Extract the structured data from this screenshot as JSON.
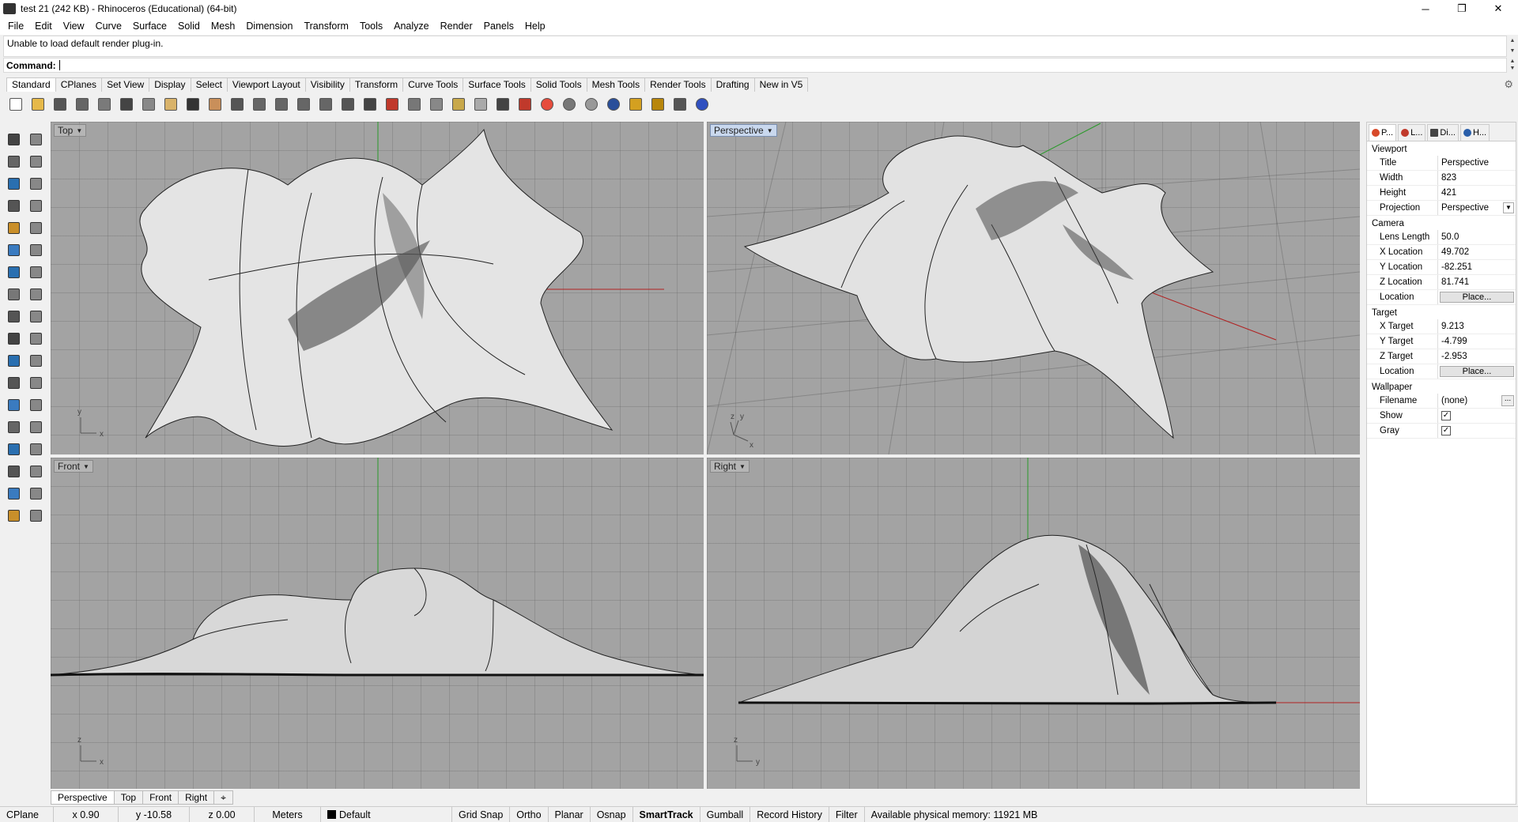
{
  "window": {
    "title": "test 21 (242 KB) - Rhinoceros (Educational) (64-bit)",
    "minimize": "─",
    "maximize": "❐",
    "close": "✕"
  },
  "menu": [
    "File",
    "Edit",
    "View",
    "Curve",
    "Surface",
    "Solid",
    "Mesh",
    "Dimension",
    "Transform",
    "Tools",
    "Analyze",
    "Render",
    "Panels",
    "Help"
  ],
  "history": {
    "text": "Unable to load default render plug-in."
  },
  "command": {
    "label": "Command:",
    "value": ""
  },
  "toolbar_tabs": [
    "Standard",
    "CPlanes",
    "Set View",
    "Display",
    "Select",
    "Viewport Layout",
    "Visibility",
    "Transform",
    "Curve Tools",
    "Surface Tools",
    "Solid Tools",
    "Mesh Tools",
    "Render Tools",
    "Drafting",
    "New in V5"
  ],
  "toolbar_icons": [
    {
      "name": "new-file-icon",
      "color": "#ffffff"
    },
    {
      "name": "open-folder-icon",
      "color": "#e6b94a"
    },
    {
      "name": "save-icon",
      "color": "#555555"
    },
    {
      "name": "print-icon",
      "color": "#666666"
    },
    {
      "name": "import-icon",
      "color": "#7a7a7a"
    },
    {
      "name": "cut-icon",
      "color": "#444444"
    },
    {
      "name": "copy-icon",
      "color": "#888888"
    },
    {
      "name": "paste-icon",
      "color": "#d9b36a"
    },
    {
      "name": "undo-icon",
      "color": "#333333"
    },
    {
      "name": "pan-hand-icon",
      "color": "#c98f5a"
    },
    {
      "name": "rotate-view-icon",
      "color": "#555555"
    },
    {
      "name": "zoom-icon",
      "color": "#666666"
    },
    {
      "name": "zoom-window-icon",
      "color": "#666666"
    },
    {
      "name": "zoom-extents-icon",
      "color": "#666666"
    },
    {
      "name": "zoom-selected-icon",
      "color": "#666666"
    },
    {
      "name": "undo-view-icon",
      "color": "#555555"
    },
    {
      "name": "four-viewports-icon",
      "color": "#444444"
    },
    {
      "name": "camera-car-icon",
      "color": "#c0392b"
    },
    {
      "name": "named-views-icon",
      "color": "#777777"
    },
    {
      "name": "cplane-icon",
      "color": "#888888"
    },
    {
      "name": "select-points-icon",
      "color": "#c8a84a"
    },
    {
      "name": "lightbulb-icon",
      "color": "#aaaaaa"
    },
    {
      "name": "lock-icon",
      "color": "#444444"
    },
    {
      "name": "layer-icon",
      "color": "#c0392b"
    },
    {
      "name": "color-wheel-icon",
      "color": "#e74c3c"
    },
    {
      "name": "shaded-sphere-icon",
      "color": "#777777"
    },
    {
      "name": "rendered-sphere-icon",
      "color": "#999999"
    },
    {
      "name": "render-sphere-icon",
      "color": "#2a4f9a"
    },
    {
      "name": "snapshot-icon",
      "color": "#d4a020"
    },
    {
      "name": "options-gear-icon",
      "color": "#b8860b"
    },
    {
      "name": "grasshopper-icon",
      "color": "#555555"
    },
    {
      "name": "help-icon",
      "color": "#3050c0"
    }
  ],
  "left_tools": [
    [
      "select-arrow-icon",
      "point-icon"
    ],
    [
      "polyline-icon",
      "curve-icon"
    ],
    [
      "circle-icon",
      "ellipse-icon"
    ],
    [
      "polygon-icon",
      "rectangle-icon"
    ],
    [
      "arc-icon",
      "curve-from-object-icon"
    ],
    [
      "surface-corner-icon",
      "surface-edit-icon"
    ],
    [
      "box-icon",
      "solid-union-icon"
    ],
    [
      "cylinder-icon",
      "extrude-icon"
    ],
    [
      "explode-icon",
      "fillet-icon"
    ],
    [
      "trim-icon",
      "split-icon"
    ],
    [
      "mesh-icon",
      "boolean-icon"
    ],
    [
      "rotate-icon",
      "scale-icon"
    ],
    [
      "text-icon",
      "dimension-icon"
    ],
    [
      "group-icon",
      "block-icon"
    ],
    [
      "render-object-icon",
      "layout-icon"
    ],
    [
      "array-icon",
      "gumball-icon"
    ],
    [
      "analyze-icon",
      "check-icon"
    ],
    [
      "material-icon",
      "paint-icon"
    ]
  ],
  "viewports": [
    {
      "id": "top",
      "label": "Top",
      "active": false,
      "axis1": "x",
      "axis2": "y"
    },
    {
      "id": "perspective",
      "label": "Perspective",
      "active": true,
      "axis1": "x",
      "axis2": "y",
      "axis3": "z"
    },
    {
      "id": "front",
      "label": "Front",
      "active": false,
      "axis1": "x",
      "axis2": "z"
    },
    {
      "id": "right",
      "label": "Right",
      "active": false,
      "axis1": "y",
      "axis2": "z"
    }
  ],
  "viewport_tabs": [
    "Perspective",
    "Top",
    "Front",
    "Right",
    "⌖"
  ],
  "panel": {
    "tabs": [
      {
        "label": "P...",
        "color": "#d84a2a"
      },
      {
        "label": "L...",
        "color": "#c0392b"
      },
      {
        "label": "Di...",
        "color": "#444444"
      },
      {
        "label": "H...",
        "color": "#2a5faa"
      }
    ],
    "viewport_section": "Viewport",
    "title_label": "Title",
    "title_value": "Perspective",
    "width_label": "Width",
    "width_value": "823",
    "height_label": "Height",
    "height_value": "421",
    "projection_label": "Projection",
    "projection_value": "Perspective",
    "camera_section": "Camera",
    "lens_label": "Lens Length",
    "lens_value": "50.0",
    "xloc_label": "X Location",
    "xloc_value": "49.702",
    "yloc_label": "Y Location",
    "yloc_value": "-82.251",
    "zloc_label": "Z Location",
    "zloc_value": "81.741",
    "location_label": "Location",
    "place_label": "Place...",
    "target_section": "Target",
    "xt_label": "X Target",
    "xt_value": "9.213",
    "yt_label": "Y Target",
    "yt_value": "-4.799",
    "zt_label": "Z Target",
    "zt_value": "-2.953",
    "tloc_label": "Location",
    "tplace_label": "Place...",
    "wallpaper_section": "Wallpaper",
    "filename_label": "Filename",
    "filename_value": "(none)",
    "filename_btn": "...",
    "show_label": "Show",
    "show_check": "✓",
    "gray_label": "Gray",
    "gray_check": "✓"
  },
  "status": {
    "cplane": "CPlane",
    "x": "x 0.90",
    "y": "y -10.58",
    "z": "z 0.00",
    "units": "Meters",
    "layer": "Default",
    "grid_snap": "Grid Snap",
    "ortho": "Ortho",
    "planar": "Planar",
    "osnap": "Osnap",
    "smarttrack": "SmartTrack",
    "gumball": "Gumball",
    "record_history": "Record History",
    "filter": "Filter",
    "memory": "Available physical memory: 11921 MB"
  }
}
